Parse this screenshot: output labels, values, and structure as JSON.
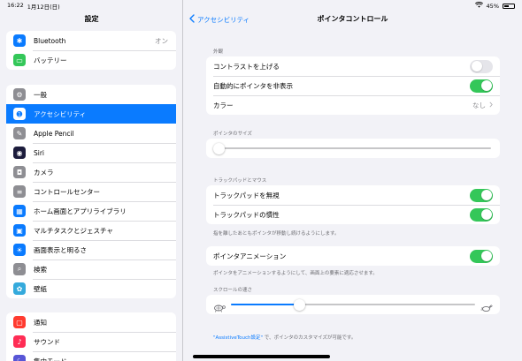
{
  "status": {
    "time": "16:22",
    "date": "1月12日(日)",
    "battery": "45%",
    "battery_level": 0.45
  },
  "sidebar": {
    "title": "設定",
    "group1": [
      {
        "label": "Bluetooth",
        "value": "オン",
        "icon": "bluetooth-icon",
        "color": "#0a7bff",
        "glyph": "✱"
      },
      {
        "label": "バッテリー",
        "icon": "battery-icon",
        "color": "#34c759",
        "glyph": "▭"
      }
    ],
    "group2": [
      {
        "label": "一般",
        "icon": "gear-icon",
        "color": "#8e8e93",
        "glyph": "⚙"
      },
      {
        "label": "アクセシビリティ",
        "icon": "accessibility-icon",
        "color": "#0a7bff",
        "glyph": "➊",
        "selected": true
      },
      {
        "label": "Apple Pencil",
        "icon": "pencil-icon",
        "color": "#8e8e93",
        "glyph": "✎"
      },
      {
        "label": "Siri",
        "icon": "siri-icon",
        "color": "#1c1c3c",
        "glyph": "◉"
      },
      {
        "label": "カメラ",
        "icon": "camera-icon",
        "color": "#8e8e93",
        "glyph": "◘"
      },
      {
        "label": "コントロールセンター",
        "icon": "control-center-icon",
        "color": "#8e8e93",
        "glyph": "≡"
      },
      {
        "label": "ホーム画面とアプリライブラリ",
        "icon": "home-screen-icon",
        "color": "#0a7bff",
        "glyph": "▦"
      },
      {
        "label": "マルチタスクとジェスチャ",
        "icon": "multitasking-icon",
        "color": "#0a7bff",
        "glyph": "▣"
      },
      {
        "label": "画面表示と明るさ",
        "icon": "brightness-icon",
        "color": "#0a7bff",
        "glyph": "☀"
      },
      {
        "label": "検索",
        "icon": "search-icon",
        "color": "#8e8e93",
        "glyph": "⌕"
      },
      {
        "label": "壁紙",
        "icon": "wallpaper-icon",
        "color": "#35aadc",
        "glyph": "✿"
      }
    ],
    "group3": [
      {
        "label": "通知",
        "icon": "notifications-icon",
        "color": "#ff3b30",
        "glyph": "▢"
      },
      {
        "label": "サウンド",
        "icon": "sound-icon",
        "color": "#ff2d55",
        "glyph": "♪"
      },
      {
        "label": "集中モード",
        "icon": "focus-icon",
        "color": "#5856d6",
        "glyph": "☾"
      }
    ]
  },
  "detail": {
    "back_label": "アクセシビリティ",
    "title": "ポインタコントロール",
    "appearance": {
      "header": "外観",
      "contrast_label": "コントラストを上げる",
      "contrast_on": false,
      "autohide_label": "自動的にポインタを非表示",
      "autohide_on": true,
      "color_label": "カラー",
      "color_value": "なし"
    },
    "pointer_size": {
      "header": "ポインタのサイズ",
      "value": 0.0
    },
    "trackpad": {
      "header": "トラックパッドとマウス",
      "disable_label": "トラックパッドを無視",
      "disable_on": true,
      "inertia_label": "トラックパッドの慣性",
      "inertia_on": true,
      "footer": "指を離したあともポインタが移動し続けるようにします。"
    },
    "animation": {
      "label": "ポインタアニメーション",
      "on": true,
      "footer": "ポインタをアニメーションするようにして、画面上の要素に適応させます。"
    },
    "scroll_speed": {
      "header": "スクロールの速さ",
      "value": 0.28
    },
    "assistive": {
      "link": "\"AssistiveTouch設定\"",
      "rest": " で、ポインタのカスタマイズが可能です。"
    }
  }
}
